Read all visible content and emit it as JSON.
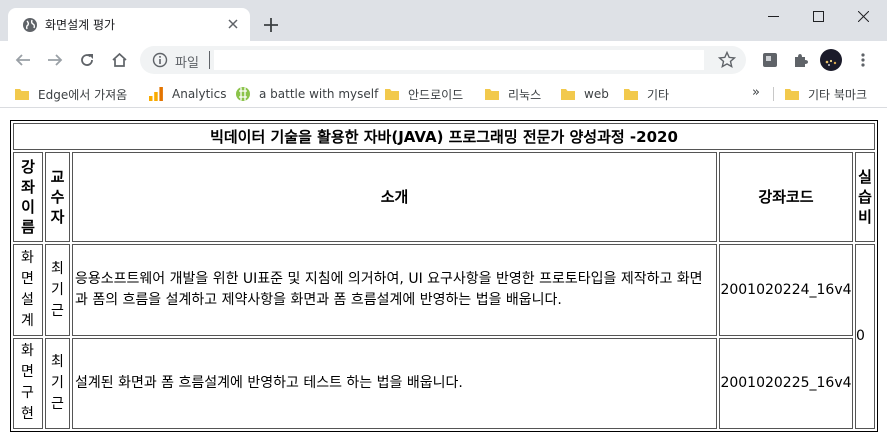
{
  "browser": {
    "tab": {
      "title": "화면설계 평가"
    },
    "address": {
      "scheme_label": "파일",
      "value": ""
    },
    "bookmarks": [
      {
        "label": "Edge에서 가져옴",
        "icon": "folder-icon"
      },
      {
        "label": "Analytics",
        "icon": "analytics-icon"
      },
      {
        "label": "a battle with myself",
        "icon": "globe-icon"
      },
      {
        "label": "안드로이드",
        "icon": "folder-icon"
      },
      {
        "label": "리눅스",
        "icon": "folder-icon"
      },
      {
        "label": "web",
        "icon": "folder-icon"
      },
      {
        "label": "기타",
        "icon": "folder-icon"
      }
    ],
    "bookmarks_more": "»",
    "other_bookmarks": "기타 북마크"
  },
  "table": {
    "caption": "빅데이터 기술을 활용한 자바(JAVA) 프로그래밍 전문가 양성과정 -2020",
    "headers": {
      "course_name": "강좌이름",
      "instructor": "교수자",
      "intro": "소개",
      "course_code": "강좌코드",
      "lab_fee": "실습비"
    },
    "rows": [
      {
        "course_name": "화면설계",
        "instructor": "최기근",
        "intro": "응용소프트웨어 개발을 위한 UI표준 및 지침에 의거하여, UI 요구사항을 반영한 프로토타입을 제작하고 화면과 폼의 흐름을 설계하고 제약사항을 화면과 폼 흐름설계에 반영하는 법을 배웁니다.",
        "course_code": "2001020224_16v4"
      },
      {
        "course_name": "화면구현",
        "instructor": "최기근",
        "intro": "설계된 화면과 폼 흐름설계에 반영하고 테스트 하는 법을 배웁니다.",
        "course_code": "2001020225_16v4"
      }
    ],
    "lab_fee": "0"
  }
}
